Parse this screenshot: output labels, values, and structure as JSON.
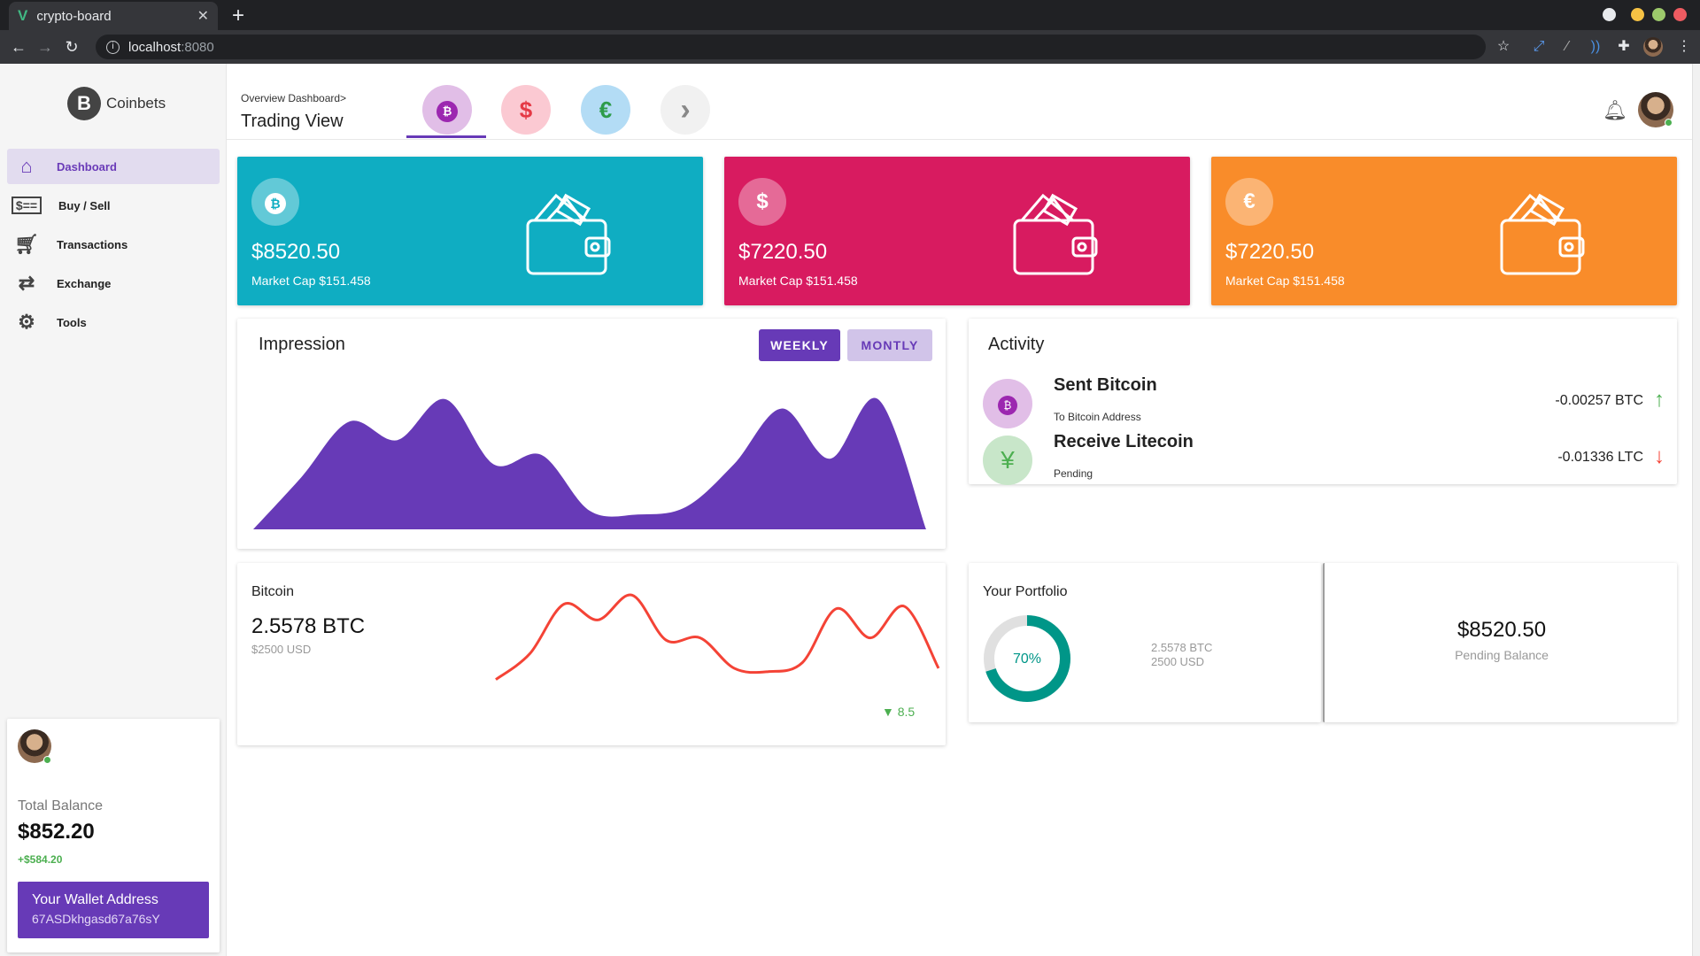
{
  "browser": {
    "tab_title": "crypto-board",
    "tab_logo": "V",
    "url_host": "localhost",
    "url_port": ":8080"
  },
  "sidebar": {
    "brand_name": "Coinbets",
    "items": [
      {
        "label": "Dashboard",
        "icon": "home-icon"
      },
      {
        "label": "Buy / Sell",
        "icon": "credit-card-icon"
      },
      {
        "label": "Transactions",
        "icon": "cart-icon"
      },
      {
        "label": "Exchange",
        "icon": "swap-icon"
      },
      {
        "label": "Tools",
        "icon": "gear-icon"
      }
    ],
    "balance": {
      "label": "Total Balance",
      "amount": "$852.20",
      "change": "+$584.20",
      "wallet_title": "Your Wallet Address",
      "wallet_address": "67ASDkhgasd67a76sY"
    }
  },
  "header": {
    "breadcrumb": "Overview Dashboard>",
    "title": "Trading View",
    "coin_tabs": [
      {
        "symbol": "₿",
        "icon": "bitcoin-icon"
      },
      {
        "symbol": "$",
        "icon": "dollar-icon"
      },
      {
        "symbol": "€",
        "icon": "euro-icon"
      },
      {
        "symbol": "›",
        "icon": "chevron-right-icon"
      }
    ]
  },
  "cards": [
    {
      "symbol": "₿",
      "amount": "$8520.50",
      "market_cap": "Market Cap $151.458",
      "color": "#0fadc2"
    },
    {
      "symbol": "$",
      "amount": "$7220.50",
      "market_cap": "Market Cap $151.458",
      "color": "#d81b60"
    },
    {
      "symbol": "€",
      "amount": "$7220.50",
      "market_cap": "Market Cap $151.458",
      "color": "#f98c2a"
    }
  ],
  "impression": {
    "title": "Impression",
    "weekly_label": "WEEKLY",
    "monthly_label": "MONTLY",
    "chart_data": {
      "type": "area",
      "values": [
        0,
        28,
        58,
        48,
        70,
        35,
        40,
        10,
        8,
        12,
        35,
        65,
        38,
        70,
        0
      ],
      "color": "#673ab7"
    }
  },
  "activity": {
    "title": "Activity",
    "items": [
      {
        "symbol": "₿",
        "name": "Sent Bitcoin",
        "sub": "To Bitcoin Address",
        "value": "-0.00257 BTC",
        "arrow": "↑",
        "arrow_color": "#4caf50",
        "icon_bg": "#e1bee7"
      },
      {
        "symbol": "¥",
        "name": "Receive Litecoin",
        "sub": "Pending",
        "value": "-0.01336 LTC",
        "arrow": "↓",
        "arrow_color": "#f44336",
        "icon_bg": "#c8e6c9"
      }
    ]
  },
  "bitcoin": {
    "title": "Bitcoin",
    "amount": "2.5578 BTC",
    "usd": "$2500 USD",
    "trend": "8.5",
    "chart_data": {
      "type": "line",
      "values": [
        5,
        28,
        72,
        58,
        80,
        40,
        42,
        15,
        12,
        20,
        68,
        42,
        70,
        15
      ],
      "color": "#f44336"
    }
  },
  "portfolio": {
    "title": "Your Portfolio",
    "percent_label": "70%",
    "percent": 70,
    "btc": "2.5578 BTC",
    "usd": "2500 USD",
    "pending_amount": "$8520.50",
    "pending_label": "Pending Balance"
  }
}
